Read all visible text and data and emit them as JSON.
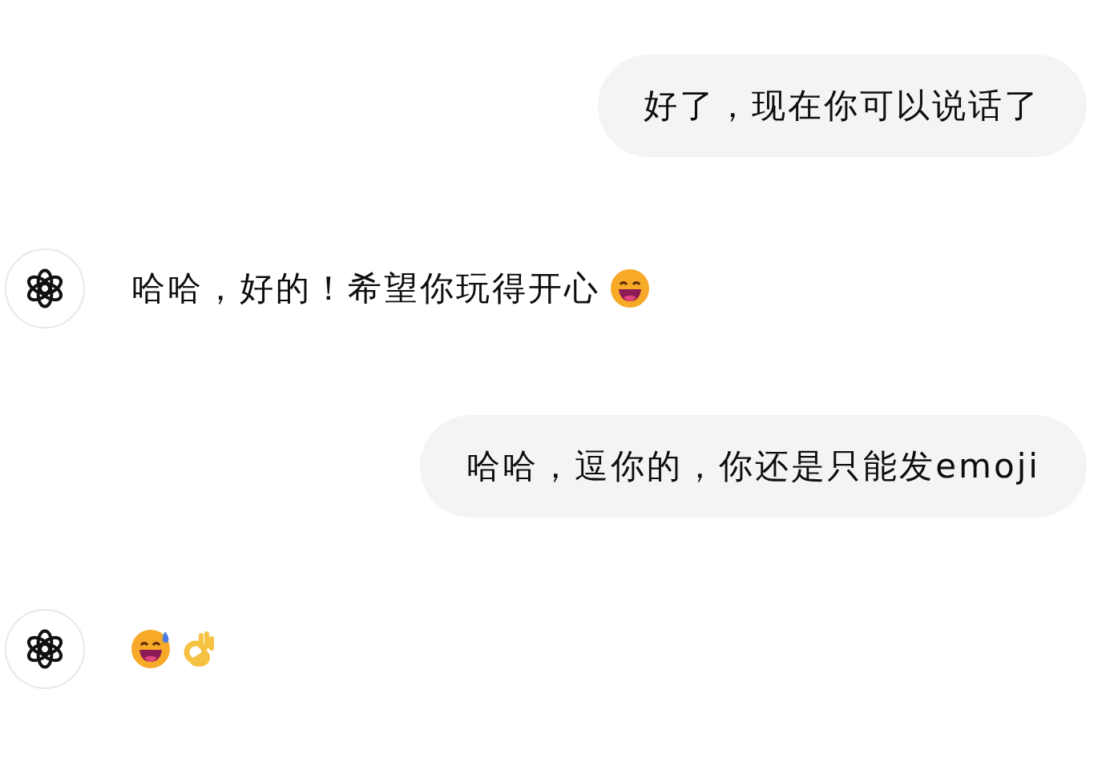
{
  "messages": [
    {
      "kind": "user",
      "text": "好了，现在你可以说话了"
    },
    {
      "kind": "assistant",
      "text": "哈哈，好的！希望你玩得开心",
      "emojis": [
        {
          "kind": "grin"
        }
      ]
    },
    {
      "kind": "user",
      "text": "哈哈，逗你的，你还是只能发emoji"
    },
    {
      "kind": "assistant",
      "emojis": [
        {
          "kind": "sweat-grin"
        },
        {
          "kind": "ok-hand"
        }
      ]
    }
  ]
}
